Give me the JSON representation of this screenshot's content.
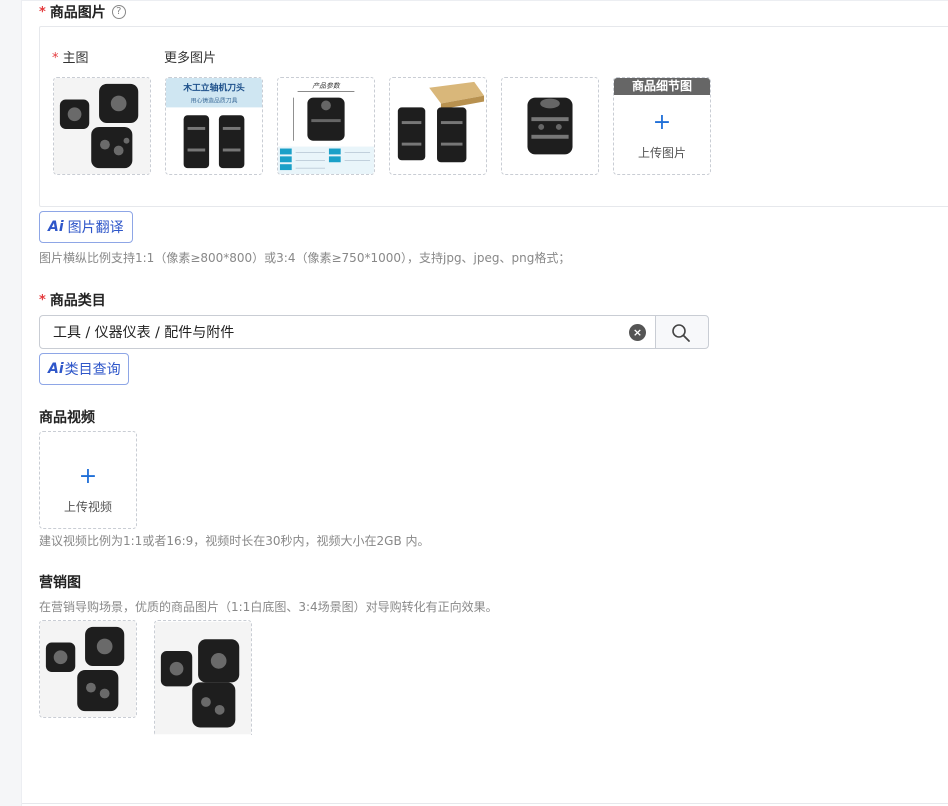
{
  "product_images": {
    "required_mark": "*",
    "title": "商品图片",
    "help_icon": "?",
    "main_label": "主图",
    "more_label": "更多图片",
    "thumb1_banner_title": "木工立轴机刀头",
    "thumb1_banner_sub": "用心铸造品质刀具",
    "thumb2_title": "产品参数",
    "detail_header": "商品细节图",
    "upload_plus": "+",
    "upload_label": "上传图片",
    "ai_mark": "Ai",
    "translate_label": "图片翻译",
    "hint": "图片横纵比例支持1:1（像素≥800*800）或3:4（像素≥750*1000），支持jpg、jpeg、png格式；"
  },
  "category": {
    "required_mark": "*",
    "title": "商品类目",
    "value": "工具 / 仪器仪表 / 配件与附件",
    "clear_icon": "×",
    "ai_mark": "Ai",
    "query_label": "类目查询"
  },
  "video": {
    "title": "商品视频",
    "upload_plus": "+",
    "upload_label": "上传视频",
    "hint": "建议视频比例为1:1或者16:9，视频时长在30秒内，视频大小在2GB 内。"
  },
  "marketing": {
    "title": "营销图",
    "hint": "在营销导购场景，优质的商品图片（1:1白底图、3:4场景图）对导购转化有正向效果。"
  }
}
